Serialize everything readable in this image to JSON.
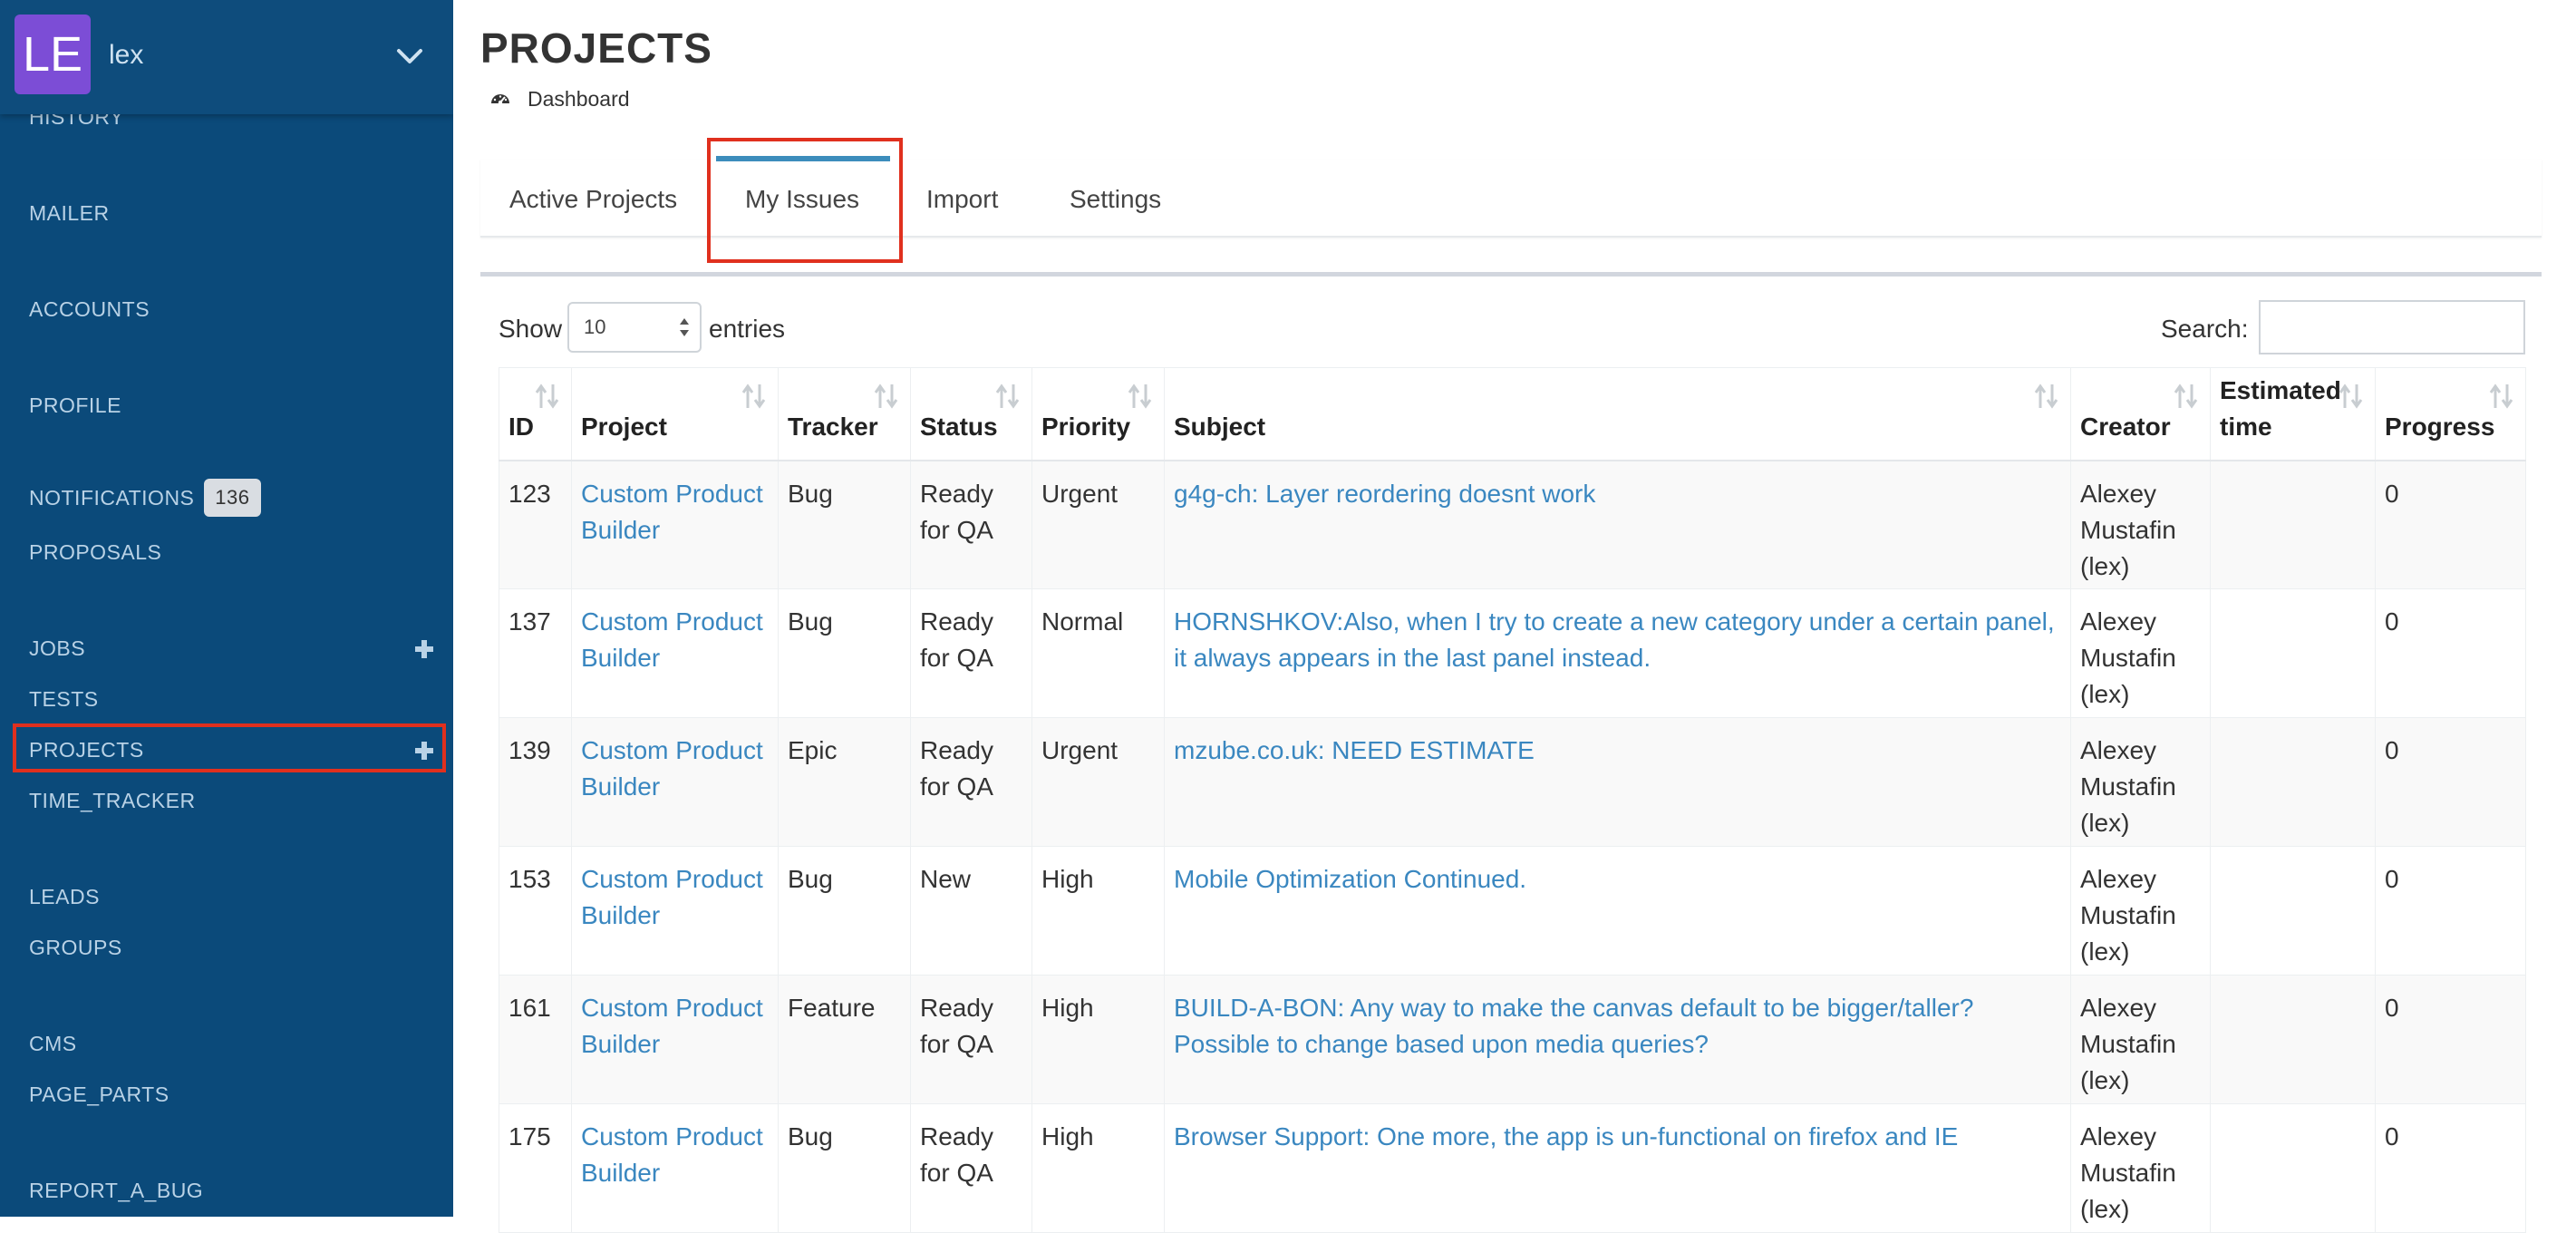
{
  "user": {
    "initials": "LE",
    "name": "lex"
  },
  "sidebar": {
    "items": [
      {
        "label": "HISTORY"
      },
      {
        "label": "MAILER"
      },
      {
        "label": "ACCOUNTS"
      },
      {
        "label": "PROFILE"
      },
      {
        "label": "NOTIFICATIONS",
        "badge": "136"
      },
      {
        "label": "PROPOSALS"
      },
      {
        "label": "JOBS"
      },
      {
        "label": "TESTS"
      },
      {
        "label": "PROJECTS"
      },
      {
        "label": "TIME_TRACKER"
      },
      {
        "label": "LEADS"
      },
      {
        "label": "GROUPS"
      },
      {
        "label": "CMS"
      },
      {
        "label": "PAGE_PARTS"
      },
      {
        "label": "REPORT_A_BUG"
      }
    ]
  },
  "page": {
    "title": "PROJECTS",
    "breadcrumb": "Dashboard"
  },
  "tabs": [
    {
      "label": "Active Projects"
    },
    {
      "label": "My Issues",
      "active": true
    },
    {
      "label": "Import"
    },
    {
      "label": "Settings"
    }
  ],
  "controls": {
    "show_label": "Show",
    "entries_value": "10",
    "entries_label": "entries",
    "search_label": "Search:",
    "search_value": ""
  },
  "table": {
    "headers": [
      "ID",
      "Project",
      "Tracker",
      "Status",
      "Priority",
      "Subject",
      "Creator",
      "Estimated time",
      "Progress"
    ],
    "rows": [
      {
        "id": "123",
        "project": "Custom Product Builder",
        "tracker": "Bug",
        "status": "Ready for QA",
        "priority": "Urgent",
        "subject": "g4g-ch: Layer reordering doesnt work",
        "creator": "Alexey Mustafin (lex)",
        "estimated": "",
        "progress": "0"
      },
      {
        "id": "137",
        "project": "Custom Product Builder",
        "tracker": "Bug",
        "status": "Ready for QA",
        "priority": "Normal",
        "subject": "HORNSHKOV:Also, when I try to create a new category under a certain panel, it always appears in the last panel instead.",
        "creator": "Alexey Mustafin (lex)",
        "estimated": "",
        "progress": "0"
      },
      {
        "id": "139",
        "project": "Custom Product Builder",
        "tracker": "Epic",
        "status": "Ready for QA",
        "priority": "Urgent",
        "subject": "mzube.co.uk: NEED ESTIMATE",
        "creator": "Alexey Mustafin (lex)",
        "estimated": "",
        "progress": "0"
      },
      {
        "id": "153",
        "project": "Custom Product Builder",
        "tracker": "Bug",
        "status": "New",
        "priority": "High",
        "subject": "Mobile Optimization Continued.",
        "creator": "Alexey Mustafin (lex)",
        "estimated": "",
        "progress": "0"
      },
      {
        "id": "161",
        "project": "Custom Product Builder",
        "tracker": "Feature",
        "status": "Ready for QA",
        "priority": "High",
        "subject": "BUILD-A-BON: Any way to make the canvas default to be bigger/taller? Possible to change based upon media queries?",
        "creator": "Alexey Mustafin (lex)",
        "estimated": "",
        "progress": "0"
      },
      {
        "id": "175",
        "project": "Custom Product Builder",
        "tracker": "Bug",
        "status": "Ready for QA",
        "priority": "High",
        "subject": "Browser Support: One more, the app is un-functional on firefox and IE",
        "creator": "Alexey Mustafin (lex)",
        "estimated": "",
        "progress": "0"
      }
    ]
  },
  "colors": {
    "sidebar_bg": "#0b4a7a",
    "avatar_bg": "#7c4dd6",
    "link": "#3a87c0",
    "active_tab": "#3c8dbc",
    "highlight": "#e0301e"
  }
}
